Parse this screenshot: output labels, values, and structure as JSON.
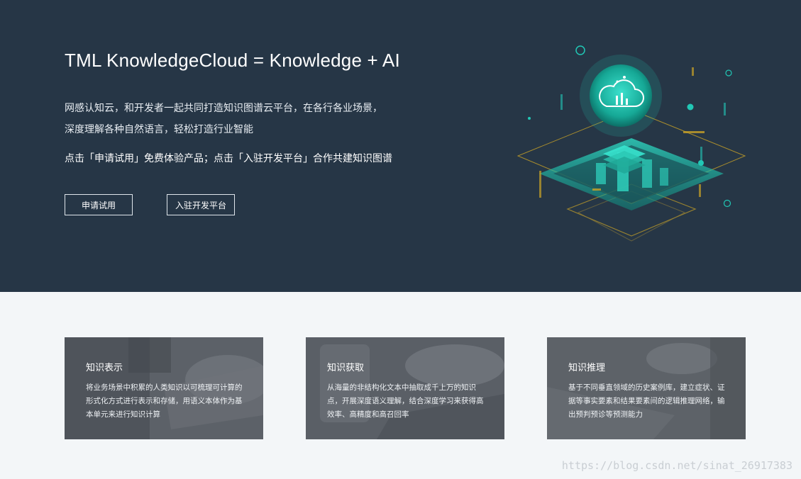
{
  "hero": {
    "title": "TML KnowledgeCloud = Knowledge + AI",
    "desc_line1": "网感认知云，和开发者一起共同打造知识图谱云平台，在各行各业场景，",
    "desc_line2": "深度理解各种自然语言，轻松打造行业智能",
    "cta_text": "点击「申请试用」免费体验产品；点击「入驻开发平台」合作共建知识图谱",
    "btn_trial": "申请试用",
    "btn_dev": "入驻开发平台",
    "illustration_icon": "cloud-chart-icon"
  },
  "cards": [
    {
      "title": "知识表示",
      "desc": "将业务场景中积累的人类知识以可梳理可计算的形式化方式进行表示和存储，用语义本体作为基本单元来进行知识计算"
    },
    {
      "title": "知识获取",
      "desc": "从海量的非结构化文本中抽取成千上万的知识点，开展深度语义理解，结合深度学习来获得高效率、高精度和高召回率"
    },
    {
      "title": "知识推理",
      "desc": "基于不同垂直领域的历史案例库，建立症状、证据等事实要素和结果要素间的逻辑推理网络，输出预判预诊等预测能力"
    }
  ],
  "watermark": "https://blog.csdn.net/sinat_26917383",
  "colors": {
    "hero_bg": "#263646",
    "page_bg": "#f3f6f8",
    "accent_teal": "#21c7b5",
    "accent_gold": "#c9a227"
  }
}
